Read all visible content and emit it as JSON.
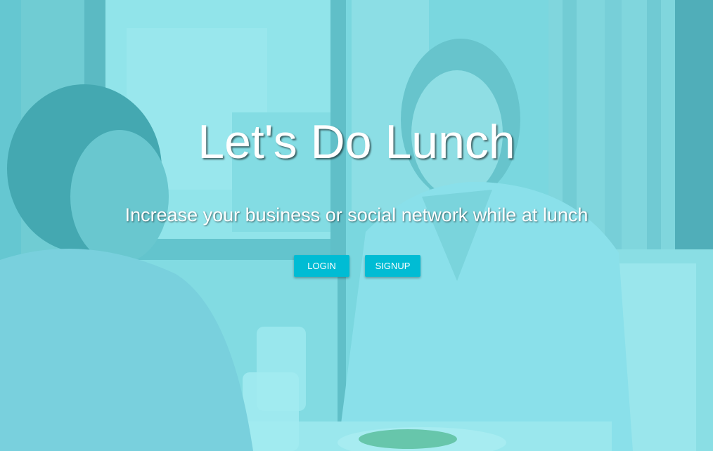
{
  "hero": {
    "title": "Let's Do Lunch",
    "subtitle": "Increase your business or social network while at lunch",
    "background_image": "two-people-having-lunch-at-restaurant",
    "overlay_color": "#00c8d7"
  },
  "actions": {
    "login_label": "LOGIN",
    "signup_label": "SIGNUP",
    "button_color": "#00bcd4"
  }
}
